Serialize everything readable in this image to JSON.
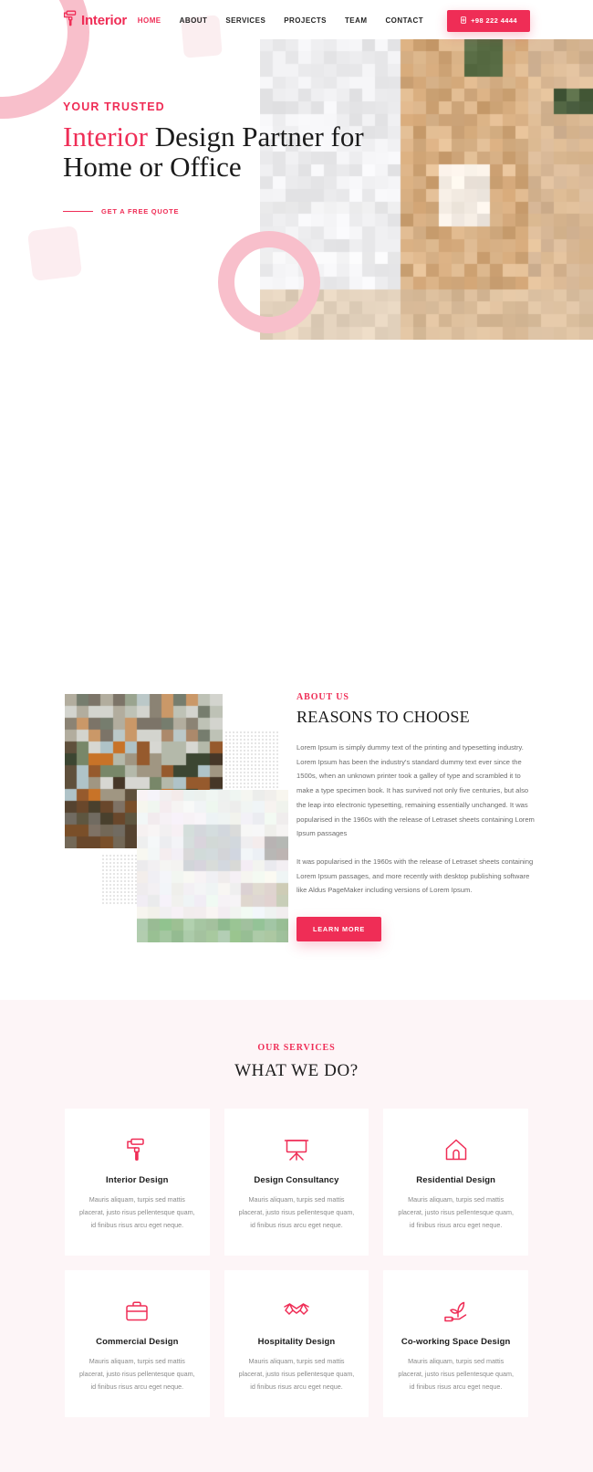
{
  "brand": {
    "name": "Interior",
    "logo_icon": "paint-roller-icon",
    "color": "#ef2d56"
  },
  "nav": {
    "items": [
      {
        "label": "HOME",
        "active": true
      },
      {
        "label": "ABOUT",
        "active": false
      },
      {
        "label": "SERVICES",
        "active": false
      },
      {
        "label": "PROJECTS",
        "active": false
      },
      {
        "label": "TEAM",
        "active": false
      },
      {
        "label": "CONTACT",
        "active": false
      }
    ],
    "phone_button": {
      "label": "+98 222 4444",
      "icon": "phone-icon"
    }
  },
  "hero": {
    "eyebrow": "YOUR TRUSTED",
    "title_highlight": "Interior",
    "title_rest": " Design Partner for Home or Office",
    "cta": "GET A FREE QUOTE",
    "image_alt": "interior-room-photo"
  },
  "about": {
    "eyebrow": "ABOUT US",
    "title": "REASONS TO CHOOSE",
    "paragraph1": "Lorem Ipsum is simply dummy text of the printing and typesetting industry. Lorem Ipsum has been the industry's standard dummy text ever since the 1500s, when an unknown printer took a galley of type and scrambled it to make a type specimen book. It has survived not only five centuries, but also the leap into electronic typesetting, remaining essentially unchanged. It was popularised in the 1960s with the release of Letraset sheets containing Lorem Ipsum passages",
    "paragraph2": "It was popularised in the 1960s with the release of Letraset sheets containing Lorem Ipsum passages, and more recently with desktop publishing software like Aldus PageMaker including versions of Lorem Ipsum.",
    "button": "LEARN MORE"
  },
  "services": {
    "eyebrow": "OUR SERVICES",
    "title": "WHAT WE DO?",
    "cards": [
      {
        "icon": "paint-roller-icon",
        "name": "Interior Design",
        "desc": "Mauris aliquam, turpis sed mattis placerat, justo risus pellentesque quam, id finibus risus arcu eget neque."
      },
      {
        "icon": "easel-board-icon",
        "name": "Design Consultancy",
        "desc": "Mauris aliquam, turpis sed mattis placerat, justo risus pellentesque quam, id finibus risus arcu eget neque."
      },
      {
        "icon": "house-icon",
        "name": "Residential Design",
        "desc": "Mauris aliquam, turpis sed mattis placerat, justo risus pellentesque quam, id finibus risus arcu eget neque."
      },
      {
        "icon": "briefcase-icon",
        "name": "Commercial Design",
        "desc": "Mauris aliquam, turpis sed mattis placerat, justo risus pellentesque quam, id finibus risus arcu eget neque."
      },
      {
        "icon": "handshake-icon",
        "name": "Hospitality Design",
        "desc": "Mauris aliquam, turpis sed mattis placerat, justo risus pellentesque quam, id finibus risus arcu eget neque."
      },
      {
        "icon": "hand-plant-icon",
        "name": "Co-working Space Design",
        "desc": "Mauris aliquam, turpis sed mattis placerat, justo risus pellentesque quam, id finibus risus arcu eget neque."
      }
    ]
  },
  "colors": {
    "accent": "#ef2d56",
    "accent_soft": "#f8bfcb",
    "section_bg": "#fdf5f7",
    "heading": "#1b1b1b",
    "body_text": "#6c6c6c"
  }
}
